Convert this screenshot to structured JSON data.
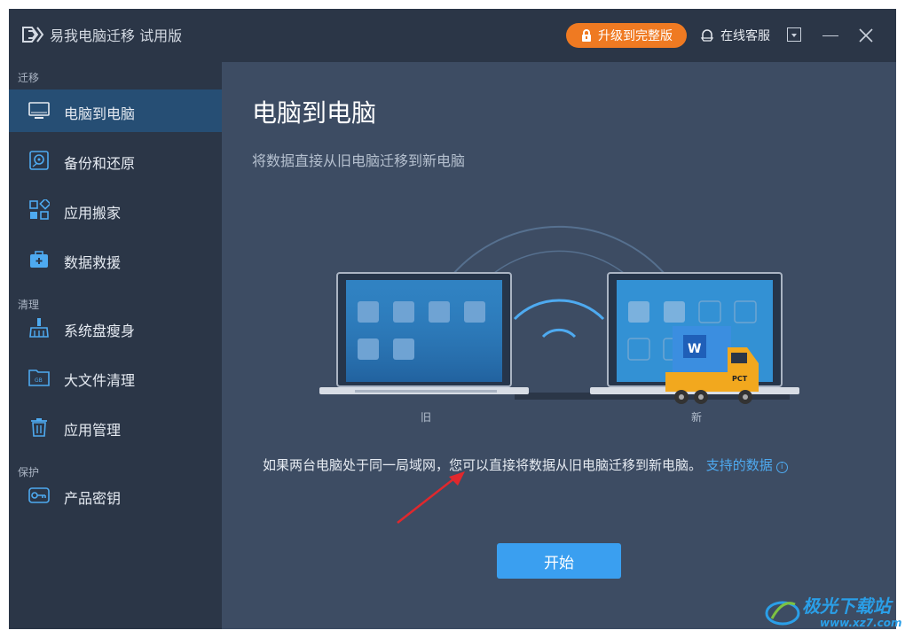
{
  "window": {
    "title": "易我电脑迁移 试用版",
    "upgrade_label": "升级到完整版",
    "service_label": "在线客服"
  },
  "sidebar": {
    "sections": [
      {
        "label": "迁移"
      },
      {
        "label": "清理"
      },
      {
        "label": "保护"
      }
    ],
    "items": [
      {
        "label": "电脑到电脑",
        "icon": "monitor-icon",
        "active": true
      },
      {
        "label": "备份和还原",
        "icon": "backup-disk-icon"
      },
      {
        "label": "应用搬家",
        "icon": "app-grid-icon"
      },
      {
        "label": "数据救援",
        "icon": "first-aid-kit-icon"
      },
      {
        "label": "系统盘瘦身",
        "icon": "broom-icon"
      },
      {
        "label": "大文件清理",
        "icon": "gb-folder-icon"
      },
      {
        "label": "应用管理",
        "icon": "trash-icon"
      },
      {
        "label": "产品密钥",
        "icon": "key-icon"
      }
    ]
  },
  "main": {
    "title": "电脑到电脑",
    "subtitle": "将数据直接从旧电脑迁移到新电脑",
    "old_label": "旧",
    "new_label": "新",
    "truck_label": "PCT",
    "info_text": "如果两台电脑处于同一局域网，您可以直接将数据从旧电脑迁移到新电脑。",
    "supported_link": "支持的数据",
    "start_button": "开始"
  },
  "watermark": {
    "text": "极光下载站",
    "url": "www.xz7.com"
  },
  "colors": {
    "accent_orange": "#ef7a22",
    "primary_blue": "#3a9ff0",
    "sidebar_bg": "#2b3647",
    "main_bg": "#3d4c63",
    "active_item": "#264e74",
    "link": "#4eaaf0"
  }
}
